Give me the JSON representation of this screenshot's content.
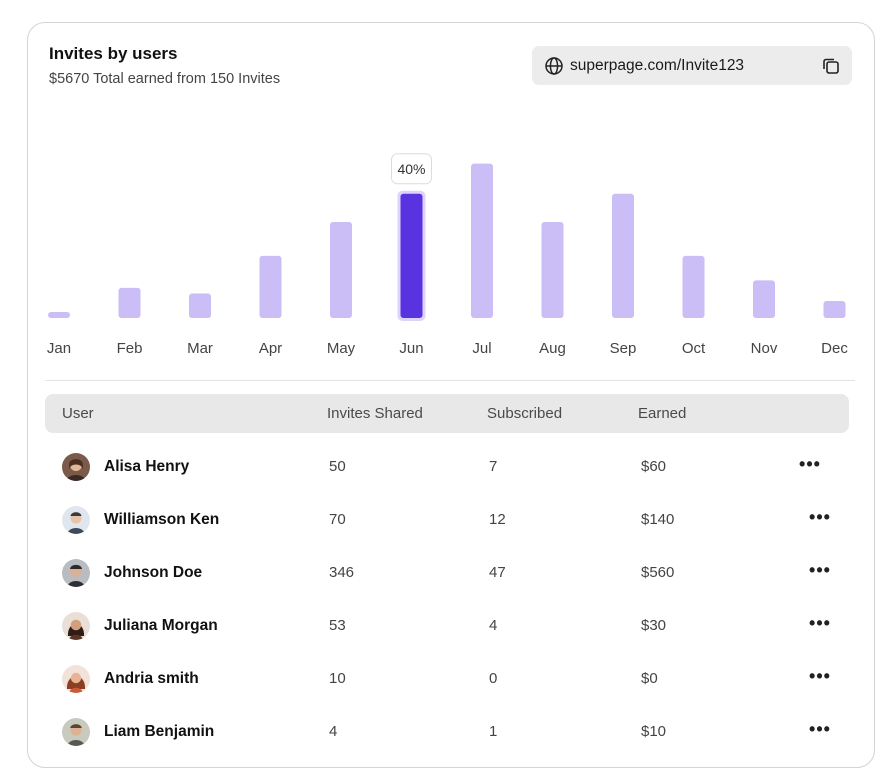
{
  "card": {
    "title": "Invites by users",
    "subtitle": "$5670 Total earned from 150 Invites"
  },
  "invite_link": {
    "url": "superpage.com/Invite123",
    "icon": "globe-icon",
    "copy_icon": "copy-icon"
  },
  "chart_data": {
    "type": "bar",
    "categories": [
      "Jan",
      "Feb",
      "Mar",
      "Apr",
      "May",
      "Jun",
      "Jul",
      "Aug",
      "Sep",
      "Oct",
      "Nov",
      "Dec"
    ],
    "values": [
      3,
      16,
      13,
      33,
      51,
      66,
      82,
      51,
      66,
      33,
      20,
      9
    ],
    "highlight_index": 5,
    "highlight_label": "40%",
    "colors": {
      "bar": "#cbbdf5",
      "highlight": "#5a33e0"
    }
  },
  "table": {
    "headers": [
      "User",
      "Invites Shared",
      "Subscribed",
      "Earned"
    ],
    "rows": [
      {
        "name": "Alisa Henry",
        "invites": "50",
        "subscribed": "7",
        "earned": "$60"
      },
      {
        "name": "Williamson Ken",
        "invites": "70",
        "subscribed": "12",
        "earned": "$140"
      },
      {
        "name": "Johnson Doe",
        "invites": "346",
        "subscribed": "47",
        "earned": "$560"
      },
      {
        "name": "Juliana Morgan",
        "invites": "53",
        "subscribed": "4",
        "earned": "$30"
      },
      {
        "name": "Andria smith",
        "invites": "10",
        "subscribed": "0",
        "earned": "$0"
      },
      {
        "name": "Liam Benjamin",
        "invites": "4",
        "subscribed": "1",
        "earned": "$10"
      }
    ],
    "more_label": "•••"
  }
}
